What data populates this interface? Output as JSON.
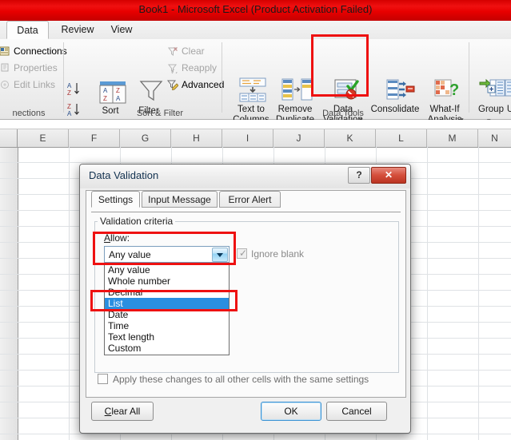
{
  "window": {
    "title": "Book1  -  Microsoft Excel (Product Activation Failed)",
    "accent_red": "#e80000"
  },
  "ribbon": {
    "tabs": [
      {
        "label": "Data",
        "active": true
      },
      {
        "label": "Review",
        "active": false
      },
      {
        "label": "View",
        "active": false
      }
    ],
    "groups": [
      {
        "label": "nections"
      },
      {
        "label": "Sort & Filter"
      },
      {
        "label": "Data Tools"
      }
    ],
    "connections_commands": [
      {
        "label": "Connections",
        "icon": "connections-icon",
        "disabled": false
      },
      {
        "label": "Properties",
        "icon": "properties-icon",
        "disabled": true
      },
      {
        "label": "Edit Links",
        "icon": "edit-links-icon",
        "disabled": true
      }
    ],
    "filter_commands": [
      {
        "label": "Clear",
        "icon": "clear-filter-icon",
        "disabled": true
      },
      {
        "label": "Reapply",
        "icon": "reapply-filter-icon",
        "disabled": true
      },
      {
        "label": "Advanced",
        "icon": "advanced-filter-icon",
        "disabled": false
      }
    ],
    "big_buttons": [
      {
        "label": "Sort",
        "icon": "sort-az-icon"
      },
      {
        "label": "Filter",
        "icon": "funnel-icon"
      },
      {
        "label_line1": "Text to",
        "label_line2": "Columns",
        "icon": "text-to-columns-icon"
      },
      {
        "label_line1": "Remove",
        "label_line2": "Duplicate",
        "icon": "remove-duplicates-icon"
      },
      {
        "label_line1": "Data",
        "label_line2": "Validation",
        "icon": "data-validation-icon"
      },
      {
        "label": "Consolidate",
        "icon": "consolidate-icon"
      },
      {
        "label_line1": "What-If",
        "label_line2": "Analysis",
        "icon": "what-if-analysis-icon"
      },
      {
        "label": "Group",
        "icon": "group-icon"
      },
      {
        "label": "U",
        "icon": "ungroup-icon"
      }
    ],
    "sort_asc_label": "A\nZ",
    "sort_desc_label": "Z\nA",
    "sort_tile_left": "A\nZ",
    "sort_tile_right": "Z\nA"
  },
  "sheet": {
    "columns": [
      "E",
      "F",
      "G",
      "H",
      "I",
      "J",
      "K",
      "L",
      "M",
      "N"
    ]
  },
  "dialog": {
    "title": "Data Validation",
    "help_glyph": "?",
    "close_glyph": "✕",
    "tabs": [
      {
        "label": "Settings",
        "selected": true
      },
      {
        "label": "Input Message",
        "selected": false
      },
      {
        "label": "Error Alert",
        "selected": false
      }
    ],
    "group_caption": "Validation criteria",
    "allow_label_accesskey": "A",
    "allow_label_rest": "llow:",
    "allow_value": "Any value",
    "allow_options": [
      "Any value",
      "Whole number",
      "Decimal",
      "List",
      "Date",
      "Time",
      "Text length",
      "Custom"
    ],
    "allow_selected_option": "List",
    "ignore_blank_label": "Ignore blank",
    "ignore_blank_checked": true,
    "ignore_blank_tick": "✓",
    "apply_all_label": "Apply these changes to all other cells with the same settings",
    "apply_all_checked": false,
    "buttons": {
      "clear_all_accesskey": "C",
      "clear_all_rest": "lear All",
      "ok": "OK",
      "cancel": "Cancel"
    }
  },
  "highlights": {
    "color": "#ee1111",
    "boxes": [
      "data-validation-ribbon-button",
      "allow-dropdown",
      "list-option"
    ]
  }
}
